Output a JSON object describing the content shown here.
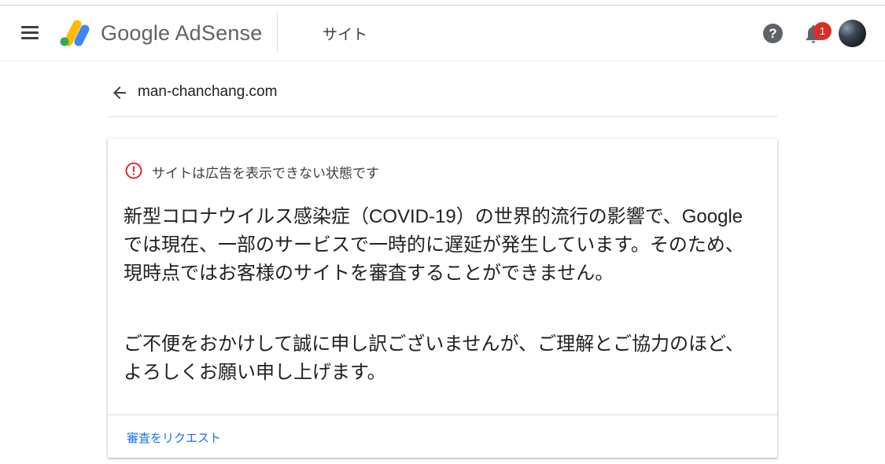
{
  "header": {
    "brand": "Google AdSense",
    "page_title": "サイト",
    "notification_count": "1",
    "help_label": "?"
  },
  "site": {
    "name": "man-chanchang.com"
  },
  "card": {
    "status": "サイトは広告を表示できない状態です",
    "paragraph1": "新型コロナウイルス感染症（COVID-19）の世界的流行の影響で、Google では現在、一部のサービスで一時的に遅延が発生しています。そのため、現時点ではお客様のサイトを審査することができません。",
    "paragraph2": "ご不便をおかけして誠に申し訳ございませんが、ご理解とご協力のほど、よろしくお願い申し上げます。",
    "action": "審査をリクエスト"
  },
  "colors": {
    "error": "#d93025",
    "link": "#1a73e8",
    "badge": "#d93025"
  },
  "icons": [
    "menu-icon",
    "adsense-logo-icon",
    "help-icon",
    "bell-icon",
    "avatar",
    "back-arrow-icon",
    "error-icon"
  ]
}
